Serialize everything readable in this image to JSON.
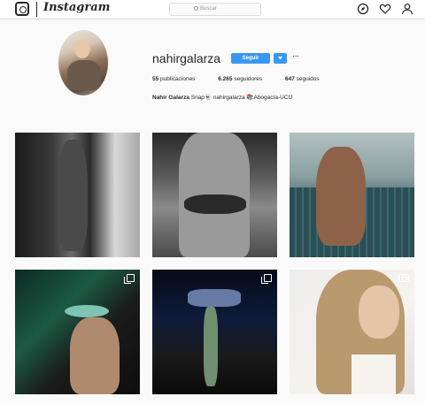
{
  "header": {
    "wordmark": "Instagram",
    "search_placeholder": "Buscar",
    "icons": [
      "instagram-glyph-icon",
      "compass-icon",
      "heart-icon",
      "user-icon"
    ]
  },
  "profile": {
    "username": "nahirgalarza",
    "follow_label": "Seguir",
    "dropdown_icon": "chevron-down-icon",
    "more_label": "···",
    "stats": {
      "posts_count": "55",
      "posts_label": "publicaciones",
      "followers_count": "6.265",
      "followers_label": "seguidores",
      "following_count": "647",
      "following_label": "seguidos"
    },
    "bio": {
      "name": "Nahir Galarza",
      "text": "Snap👻 nahirgalarza 📚Abogacía-UCU"
    }
  },
  "posts": [
    {
      "type": "photo"
    },
    {
      "type": "photo"
    },
    {
      "type": "photo"
    },
    {
      "type": "carousel",
      "icon": "multiple-images-icon"
    },
    {
      "type": "carousel",
      "icon": "multiple-images-icon"
    },
    {
      "type": "video",
      "icon": "video-camera-icon"
    }
  ],
  "colors": {
    "accent": "#3897f0",
    "background": "#fafafa",
    "text": "#262626"
  }
}
